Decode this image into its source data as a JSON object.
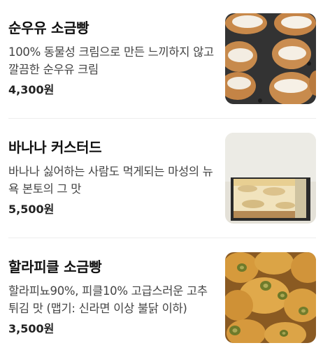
{
  "menu": {
    "items": [
      {
        "name": "순우유 소금빵",
        "description": "100% 동물성 크림으로 만든 느끼하지 않고 깔끔한 순우유 크림",
        "price": "4,300원",
        "image_icon": "cream-bread-photo"
      },
      {
        "name": "바나나 커스터드",
        "description": "바나나 싫어하는 사람도 먹게되는 마성의 뉴욕 본토의 그 맛",
        "price": "5,500원",
        "image_icon": "banana-custard-photo"
      },
      {
        "name": "할라피클 소금빵",
        "description": "할라피뇨90%, 피클10% 고급스러운 고추튀김 맛 (맵기: 신라면 이상 불닭 이하)",
        "price": "3,500원",
        "image_icon": "jalapeno-bread-photo"
      }
    ]
  },
  "colors": {
    "title": "#111111",
    "description": "#444444",
    "divider": "#eeeeee"
  }
}
